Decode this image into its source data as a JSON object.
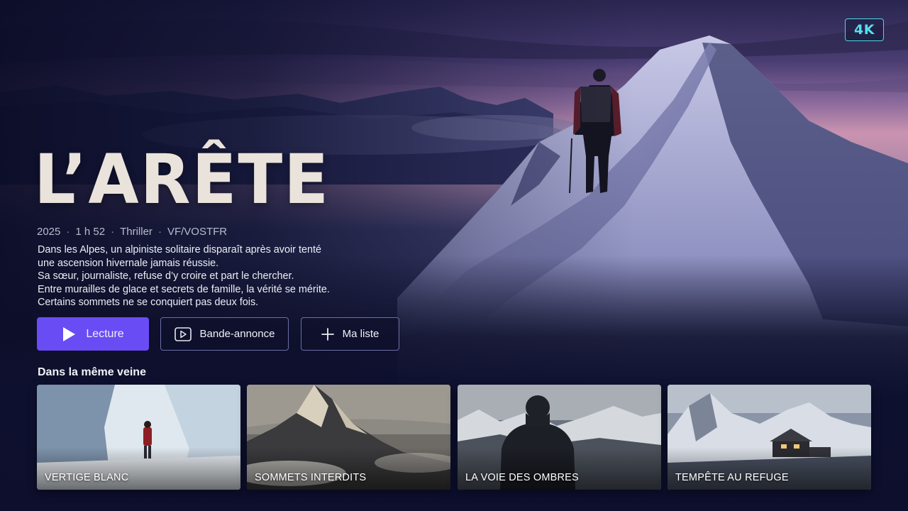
{
  "badge": "4K",
  "title": "L’ARÊTE",
  "meta": {
    "year": "2025",
    "duration": "1 h 52",
    "genre": "Thriller",
    "audio": "VF/VOSTFR",
    "separator": "·"
  },
  "synopsis": [
    "Dans les Alpes, un alpiniste solitaire disparaît après avoir tenté",
    "une ascension hivernale jamais réussie.",
    "Sa sœur, journaliste, refuse d’y croire et part le chercher.",
    "Entre murailles de glace et secrets de famille, la vérité se mérite.",
    "Certains sommets ne se conquiert pas deux fois."
  ],
  "buttons": {
    "play": {
      "label": "Lecture",
      "icon": "play-icon"
    },
    "trailer": {
      "label": "Bande-annonce",
      "icon": "trailer-icon"
    },
    "list": {
      "label": "Ma liste",
      "icon": "plus-icon"
    }
  },
  "row": {
    "title": "Dans la même veine",
    "items": [
      {
        "title": "VERTIGE BLANC"
      },
      {
        "title": "SOMMETS INTERDITS"
      },
      {
        "title": "LA VOIE DES OMBRES"
      },
      {
        "title": "TEMPÊTE AU REFUGE"
      }
    ]
  },
  "colors": {
    "accent": "#6a4cf4",
    "badge": "#49d8e6",
    "background": "#0d1028"
  }
}
